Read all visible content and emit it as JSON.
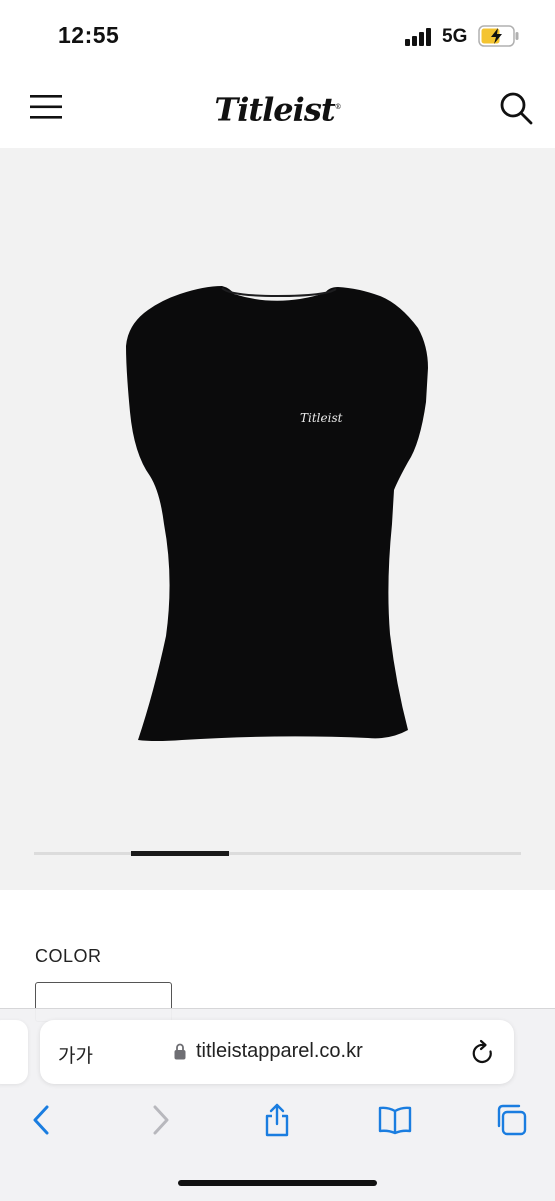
{
  "status_bar": {
    "time": "12:55",
    "network": "5G"
  },
  "header": {
    "logo": "Titleist"
  },
  "product": {
    "chest_logo": "Titleist",
    "gallery_position": 0.2
  },
  "options": {
    "color_label": "COLOR"
  },
  "browser": {
    "text_size_label": "가가",
    "url": "titleistapparel.co.kr"
  },
  "colors": {
    "accent": "#1a7de0",
    "disabled": "#b8b8bd",
    "gallery_bg": "#f2f2f2"
  }
}
